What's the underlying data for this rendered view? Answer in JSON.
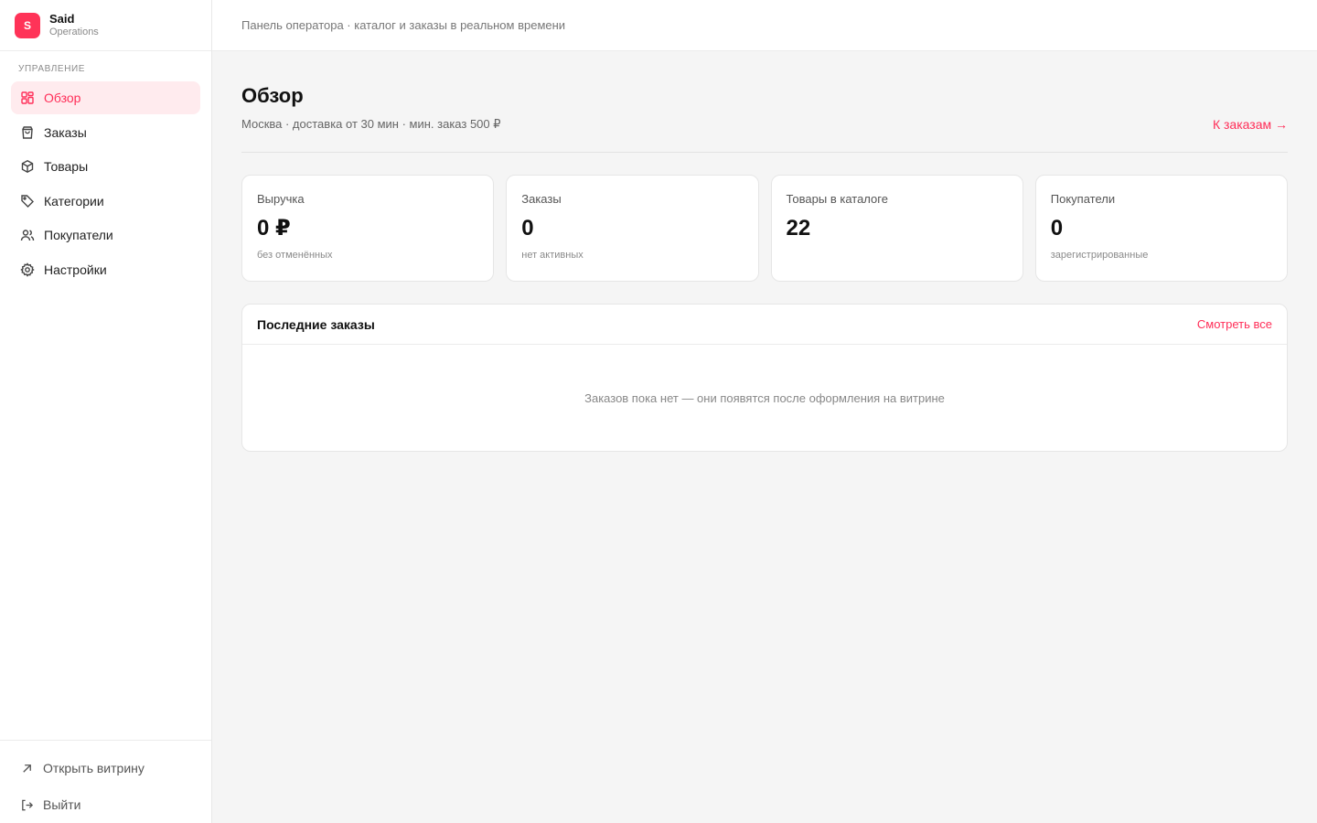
{
  "brand": {
    "logo_letter": "S",
    "name": "Said",
    "subtitle": "Operations",
    "accent_color": "#ff3358"
  },
  "sidebar": {
    "section_label": "УПРАВЛЕНИЕ",
    "items": [
      {
        "label": "Обзор",
        "icon": "grid-icon",
        "active": true
      },
      {
        "label": "Заказы",
        "icon": "shopping-bag-icon"
      },
      {
        "label": "Товары",
        "icon": "package-icon"
      },
      {
        "label": "Категории",
        "icon": "tag-icon"
      },
      {
        "label": "Покупатели",
        "icon": "users-icon"
      },
      {
        "label": "Настройки",
        "icon": "gear-icon"
      }
    ],
    "bottom": [
      {
        "label": "Открыть витрину",
        "icon": "arrow-up-right-icon"
      },
      {
        "label": "Выйти",
        "icon": "logout-icon"
      }
    ]
  },
  "topbar": {
    "text": "Панель оператора · каталог и заказы в реальном времени"
  },
  "page": {
    "title": "Обзор",
    "subtitle": "Москва · доставка от 30 мин · мин. заказ 500 ₽",
    "link": "К заказам →"
  },
  "stats": [
    {
      "label": "Выручка",
      "value": "0 ₽",
      "note": "без отменённых"
    },
    {
      "label": "Заказы",
      "value": "0",
      "note": "нет активных"
    },
    {
      "label": "Товары в каталоге",
      "value": "22",
      "note": ""
    },
    {
      "label": "Покупатели",
      "value": "0",
      "note": "зарегистрированные"
    }
  ],
  "recent_orders": {
    "title": "Последние заказы",
    "see_all": "Смотреть все",
    "empty_text": "Заказов пока нет — они появятся после оформления на витрине"
  }
}
